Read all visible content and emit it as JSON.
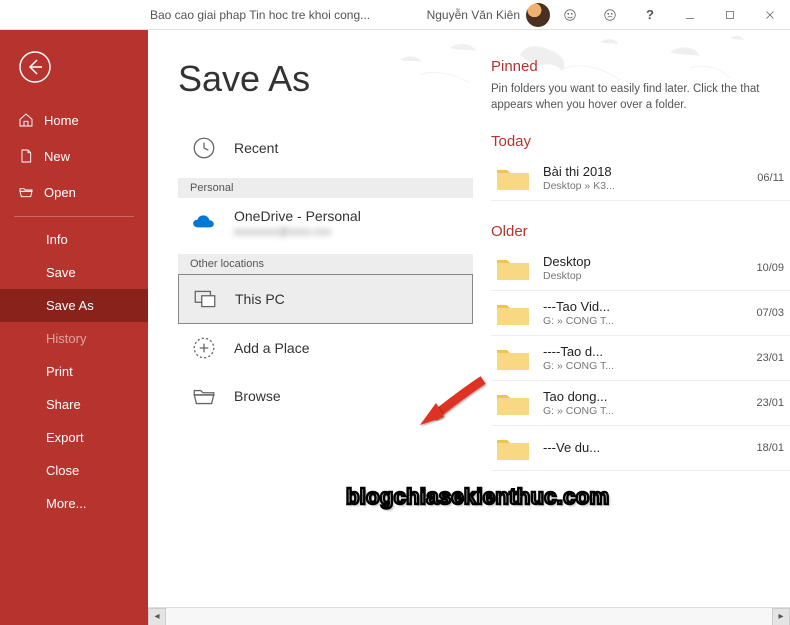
{
  "titlebar": {
    "document_title": "Bao cao giai phap Tin hoc tre khoi cong...",
    "user_name": "Nguyễn Văn Kiên"
  },
  "sidebar": {
    "items": [
      {
        "label": "Home",
        "icon": "home"
      },
      {
        "label": "New",
        "icon": "file"
      },
      {
        "label": "Open",
        "icon": "folder-open"
      }
    ],
    "sub_items": [
      {
        "label": "Info"
      },
      {
        "label": "Save"
      },
      {
        "label": "Save As",
        "active": true
      },
      {
        "label": "History",
        "dim": true
      },
      {
        "label": "Print"
      },
      {
        "label": "Share"
      },
      {
        "label": "Export"
      },
      {
        "label": "Close"
      },
      {
        "label": "More..."
      }
    ]
  },
  "main": {
    "title": "Save As",
    "locations": {
      "recent": "Recent",
      "section_personal": "Personal",
      "onedrive": "OneDrive - Personal",
      "onedrive_sub": "xxxxxxxx@xxxx.xxx",
      "section_other": "Other locations",
      "this_pc": "This PC",
      "add_place": "Add a Place",
      "browse": "Browse"
    },
    "right": {
      "pinned_title": "Pinned",
      "pinned_desc": "Pin folders you want to easily find later. Click the that appears when you hover over a folder.",
      "today_title": "Today",
      "older_title": "Older",
      "folders": {
        "today": [
          {
            "name": "Bài thi 2018",
            "path": "Desktop » K3...",
            "date": "06/11"
          }
        ],
        "older": [
          {
            "name": "Desktop",
            "path": "Desktop",
            "date": "10/09"
          },
          {
            "name": "---Tao Vid...",
            "path": "G: » CONG T...",
            "date": "07/03"
          },
          {
            "name": "----Tao d...",
            "path": "G: » CONG T...",
            "date": "23/01"
          },
          {
            "name": "Tao dong...",
            "path": "G: » CONG T...",
            "date": "23/01"
          },
          {
            "name": "---Ve  du...",
            "path": "",
            "date": "18/01"
          }
        ]
      }
    }
  },
  "watermark": "blogchiasekienthuc.com"
}
